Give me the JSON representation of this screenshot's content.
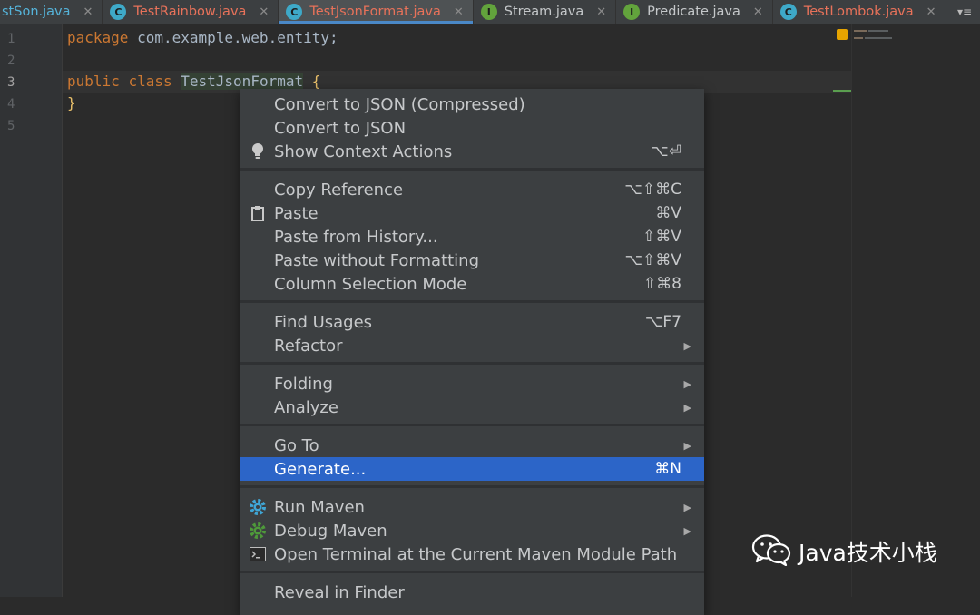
{
  "tabs": [
    {
      "label": "stSon.java",
      "icon": "none",
      "color": "cyan",
      "active": false
    },
    {
      "label": "TestRainbow.java",
      "icon": "c",
      "color": "red",
      "active": false
    },
    {
      "label": "TestJsonFormat.java",
      "icon": "c",
      "color": "red",
      "active": true
    },
    {
      "label": "Stream.java",
      "icon": "i",
      "color": "light",
      "active": false
    },
    {
      "label": "Predicate.java",
      "icon": "i",
      "color": "light",
      "active": false
    },
    {
      "label": "TestLombok.java",
      "icon": "c",
      "color": "red",
      "active": false
    }
  ],
  "tab_icons": {
    "class_letter": "C",
    "interface_letter": "I",
    "close": "✕",
    "overflow": "▾≡"
  },
  "editor": {
    "line_numbers": [
      "1",
      "2",
      "3",
      "4",
      "5"
    ],
    "current_line": "3",
    "line1": {
      "kw": "package",
      "rest": " com.example.web.entity;"
    },
    "line3": {
      "kw1": "public",
      "kw2": "class",
      "name": "TestJsonFormat",
      "brace": "{"
    },
    "line4": {
      "brace": "}"
    }
  },
  "context_menu": {
    "items": [
      {
        "label": "Convert to JSON (Compressed)",
        "shortcut": "",
        "submenu": false,
        "icon": ""
      },
      {
        "label": "Convert to JSON",
        "shortcut": "",
        "submenu": false,
        "icon": ""
      },
      {
        "label": "Show Context Actions",
        "shortcut": "⌥⏎",
        "submenu": false,
        "icon": "bulb-icon"
      },
      {
        "label": "Copy Reference",
        "shortcut": "⌥⇧⌘C",
        "submenu": false,
        "icon": ""
      },
      {
        "label": "Paste",
        "shortcut": "⌘V",
        "submenu": false,
        "icon": "clipboard-icon"
      },
      {
        "label": "Paste from History...",
        "shortcut": "⇧⌘V",
        "submenu": false,
        "icon": ""
      },
      {
        "label": "Paste without Formatting",
        "shortcut": "⌥⇧⌘V",
        "submenu": false,
        "icon": ""
      },
      {
        "label": "Column Selection Mode",
        "shortcut": "⇧⌘8",
        "submenu": false,
        "icon": ""
      },
      {
        "label": "Find Usages",
        "shortcut": "⌥F7",
        "submenu": false,
        "icon": ""
      },
      {
        "label": "Refactor",
        "shortcut": "",
        "submenu": true,
        "icon": ""
      },
      {
        "label": "Folding",
        "shortcut": "",
        "submenu": true,
        "icon": ""
      },
      {
        "label": "Analyze",
        "shortcut": "",
        "submenu": true,
        "icon": ""
      },
      {
        "label": "Go To",
        "shortcut": "",
        "submenu": true,
        "icon": ""
      },
      {
        "label": "Generate...",
        "shortcut": "⌘N",
        "submenu": false,
        "icon": "",
        "selected": true
      },
      {
        "label": "Run Maven",
        "shortcut": "",
        "submenu": true,
        "icon": "maven-run-gear-icon"
      },
      {
        "label": "Debug Maven",
        "shortcut": "",
        "submenu": true,
        "icon": "maven-debug-gear-icon"
      },
      {
        "label": "Open Terminal at the Current Maven Module Path",
        "shortcut": "",
        "submenu": false,
        "icon": "terminal-icon"
      },
      {
        "label": "Reveal in Finder",
        "shortcut": "",
        "submenu": false,
        "icon": ""
      }
    ],
    "submenu_arrow": "▶"
  },
  "watermark": {
    "text": "Java技术小栈"
  },
  "colors": {
    "keyword": "#cc7832",
    "selection": "#2c65c8",
    "active_tab_underline": "#4a88c7",
    "warning": "#e6a400"
  }
}
